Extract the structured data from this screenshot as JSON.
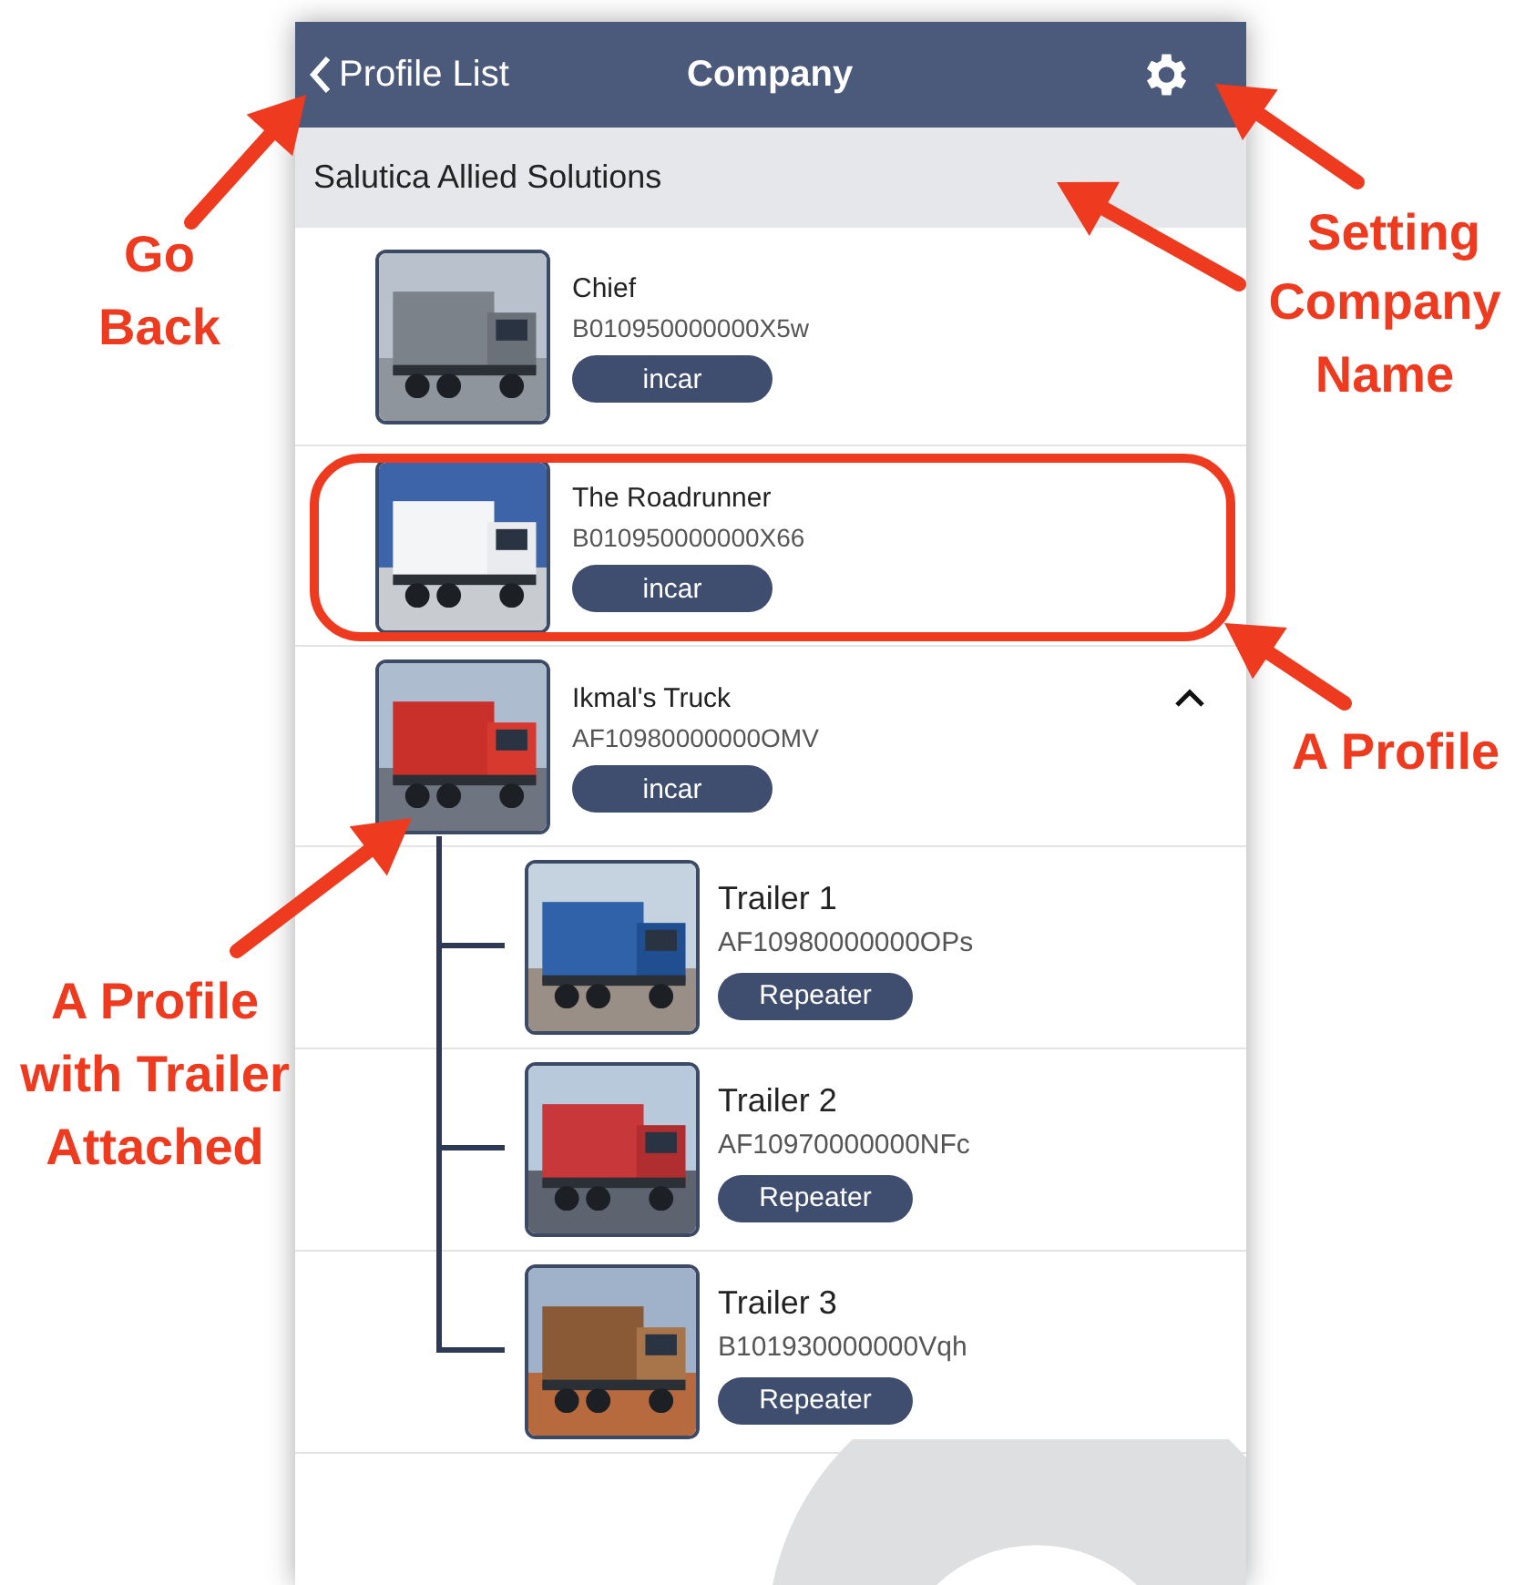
{
  "header": {
    "back_label": "Profile List",
    "title": "Company"
  },
  "company_name": "Salutica Allied Solutions",
  "profiles": [
    {
      "name": "Chief",
      "code": "B010950000000X5w",
      "tag": "incar",
      "highlighted": false
    },
    {
      "name": "The Roadrunner",
      "code": "B010950000000X66",
      "tag": "incar",
      "highlighted": true
    },
    {
      "name": "Ikmal's Truck",
      "code": "AF10980000000OMV",
      "tag": "incar",
      "highlighted": false,
      "expanded": true,
      "children": [
        {
          "name": "Trailer 1",
          "code": "AF10980000000OPs",
          "tag": "Repeater"
        },
        {
          "name": "Trailer 2",
          "code": "AF10970000000NFc",
          "tag": "Repeater"
        },
        {
          "name": "Trailer 3",
          "code": "B101930000000Vqh",
          "tag": "Repeater"
        }
      ]
    }
  ],
  "annotations": [
    {
      "text": "Go Back"
    },
    {
      "text": "Setting"
    },
    {
      "text": "Company Name"
    },
    {
      "text": "A Profile"
    },
    {
      "text": "A Profile with Trailer Attached"
    }
  ]
}
